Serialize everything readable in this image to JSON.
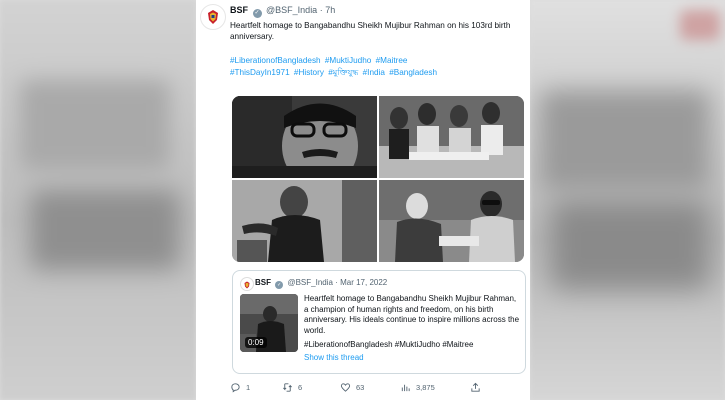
{
  "tweet": {
    "author_name": "BSF",
    "handle": "@BSF_India",
    "separator": "·",
    "time": "7h",
    "text": "Heartfelt homage to Bangabandhu Sheikh Mujibur Rahman on his 103rd birth anniversary.",
    "hashtags": [
      "#LiberationofBangladesh",
      "#MuktiJudho",
      "#Maitree",
      "#ThisDayIn1971",
      "#History",
      "#মুক্তিযুদ্ধ",
      "#India",
      "#Bangladesh"
    ]
  },
  "quoted_tweet": {
    "author_name": "BSF",
    "handle": "@BSF_India",
    "separator": "·",
    "date": "Mar 17, 2022",
    "text": "Heartfelt homage to Bangabandhu Sheikh Mujibur Rahman, a champion of human rights and freedom, on his birth anniversary. His ideals continue to inspire millions across the world.",
    "hashtags": "#LiberationofBangladesh #MuktiJudho #Maitree",
    "video_duration": "0:09",
    "show_thread": "Show this thread"
  },
  "actions": {
    "replies": "1",
    "retweets": "6",
    "likes": "63",
    "views": "3,875"
  },
  "icons": {
    "verified": "verified-badge-icon",
    "reply": "reply-icon",
    "retweet": "retweet-icon",
    "like": "heart-icon",
    "views": "views-icon",
    "share": "share-icon"
  },
  "colors": {
    "link": "#1d9bf0",
    "text": "#0f1419",
    "muted": "#536471",
    "verified_badge": "#829aab"
  }
}
